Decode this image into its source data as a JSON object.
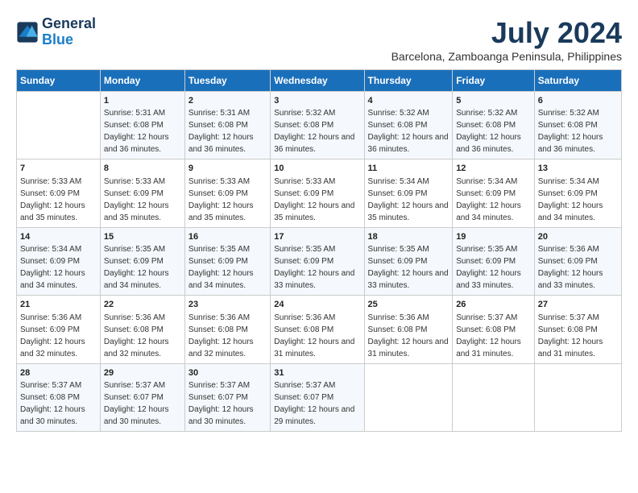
{
  "logo": {
    "line1": "General",
    "line2": "Blue"
  },
  "title": "July 2024",
  "subtitle": "Barcelona, Zamboanga Peninsula, Philippines",
  "weekdays": [
    "Sunday",
    "Monday",
    "Tuesday",
    "Wednesday",
    "Thursday",
    "Friday",
    "Saturday"
  ],
  "weeks": [
    [
      {
        "day": "",
        "sunrise": "",
        "sunset": "",
        "daylight": ""
      },
      {
        "day": "1",
        "sunrise": "Sunrise: 5:31 AM",
        "sunset": "Sunset: 6:08 PM",
        "daylight": "Daylight: 12 hours and 36 minutes."
      },
      {
        "day": "2",
        "sunrise": "Sunrise: 5:31 AM",
        "sunset": "Sunset: 6:08 PM",
        "daylight": "Daylight: 12 hours and 36 minutes."
      },
      {
        "day": "3",
        "sunrise": "Sunrise: 5:32 AM",
        "sunset": "Sunset: 6:08 PM",
        "daylight": "Daylight: 12 hours and 36 minutes."
      },
      {
        "day": "4",
        "sunrise": "Sunrise: 5:32 AM",
        "sunset": "Sunset: 6:08 PM",
        "daylight": "Daylight: 12 hours and 36 minutes."
      },
      {
        "day": "5",
        "sunrise": "Sunrise: 5:32 AM",
        "sunset": "Sunset: 6:08 PM",
        "daylight": "Daylight: 12 hours and 36 minutes."
      },
      {
        "day": "6",
        "sunrise": "Sunrise: 5:32 AM",
        "sunset": "Sunset: 6:08 PM",
        "daylight": "Daylight: 12 hours and 36 minutes."
      }
    ],
    [
      {
        "day": "7",
        "sunrise": "Sunrise: 5:33 AM",
        "sunset": "Sunset: 6:09 PM",
        "daylight": "Daylight: 12 hours and 35 minutes."
      },
      {
        "day": "8",
        "sunrise": "Sunrise: 5:33 AM",
        "sunset": "Sunset: 6:09 PM",
        "daylight": "Daylight: 12 hours and 35 minutes."
      },
      {
        "day": "9",
        "sunrise": "Sunrise: 5:33 AM",
        "sunset": "Sunset: 6:09 PM",
        "daylight": "Daylight: 12 hours and 35 minutes."
      },
      {
        "day": "10",
        "sunrise": "Sunrise: 5:33 AM",
        "sunset": "Sunset: 6:09 PM",
        "daylight": "Daylight: 12 hours and 35 minutes."
      },
      {
        "day": "11",
        "sunrise": "Sunrise: 5:34 AM",
        "sunset": "Sunset: 6:09 PM",
        "daylight": "Daylight: 12 hours and 35 minutes."
      },
      {
        "day": "12",
        "sunrise": "Sunrise: 5:34 AM",
        "sunset": "Sunset: 6:09 PM",
        "daylight": "Daylight: 12 hours and 34 minutes."
      },
      {
        "day": "13",
        "sunrise": "Sunrise: 5:34 AM",
        "sunset": "Sunset: 6:09 PM",
        "daylight": "Daylight: 12 hours and 34 minutes."
      }
    ],
    [
      {
        "day": "14",
        "sunrise": "Sunrise: 5:34 AM",
        "sunset": "Sunset: 6:09 PM",
        "daylight": "Daylight: 12 hours and 34 minutes."
      },
      {
        "day": "15",
        "sunrise": "Sunrise: 5:35 AM",
        "sunset": "Sunset: 6:09 PM",
        "daylight": "Daylight: 12 hours and 34 minutes."
      },
      {
        "day": "16",
        "sunrise": "Sunrise: 5:35 AM",
        "sunset": "Sunset: 6:09 PM",
        "daylight": "Daylight: 12 hours and 34 minutes."
      },
      {
        "day": "17",
        "sunrise": "Sunrise: 5:35 AM",
        "sunset": "Sunset: 6:09 PM",
        "daylight": "Daylight: 12 hours and 33 minutes."
      },
      {
        "day": "18",
        "sunrise": "Sunrise: 5:35 AM",
        "sunset": "Sunset: 6:09 PM",
        "daylight": "Daylight: 12 hours and 33 minutes."
      },
      {
        "day": "19",
        "sunrise": "Sunrise: 5:35 AM",
        "sunset": "Sunset: 6:09 PM",
        "daylight": "Daylight: 12 hours and 33 minutes."
      },
      {
        "day": "20",
        "sunrise": "Sunrise: 5:36 AM",
        "sunset": "Sunset: 6:09 PM",
        "daylight": "Daylight: 12 hours and 33 minutes."
      }
    ],
    [
      {
        "day": "21",
        "sunrise": "Sunrise: 5:36 AM",
        "sunset": "Sunset: 6:09 PM",
        "daylight": "Daylight: 12 hours and 32 minutes."
      },
      {
        "day": "22",
        "sunrise": "Sunrise: 5:36 AM",
        "sunset": "Sunset: 6:08 PM",
        "daylight": "Daylight: 12 hours and 32 minutes."
      },
      {
        "day": "23",
        "sunrise": "Sunrise: 5:36 AM",
        "sunset": "Sunset: 6:08 PM",
        "daylight": "Daylight: 12 hours and 32 minutes."
      },
      {
        "day": "24",
        "sunrise": "Sunrise: 5:36 AM",
        "sunset": "Sunset: 6:08 PM",
        "daylight": "Daylight: 12 hours and 31 minutes."
      },
      {
        "day": "25",
        "sunrise": "Sunrise: 5:36 AM",
        "sunset": "Sunset: 6:08 PM",
        "daylight": "Daylight: 12 hours and 31 minutes."
      },
      {
        "day": "26",
        "sunrise": "Sunrise: 5:37 AM",
        "sunset": "Sunset: 6:08 PM",
        "daylight": "Daylight: 12 hours and 31 minutes."
      },
      {
        "day": "27",
        "sunrise": "Sunrise: 5:37 AM",
        "sunset": "Sunset: 6:08 PM",
        "daylight": "Daylight: 12 hours and 31 minutes."
      }
    ],
    [
      {
        "day": "28",
        "sunrise": "Sunrise: 5:37 AM",
        "sunset": "Sunset: 6:08 PM",
        "daylight": "Daylight: 12 hours and 30 minutes."
      },
      {
        "day": "29",
        "sunrise": "Sunrise: 5:37 AM",
        "sunset": "Sunset: 6:07 PM",
        "daylight": "Daylight: 12 hours and 30 minutes."
      },
      {
        "day": "30",
        "sunrise": "Sunrise: 5:37 AM",
        "sunset": "Sunset: 6:07 PM",
        "daylight": "Daylight: 12 hours and 30 minutes."
      },
      {
        "day": "31",
        "sunrise": "Sunrise: 5:37 AM",
        "sunset": "Sunset: 6:07 PM",
        "daylight": "Daylight: 12 hours and 29 minutes."
      },
      {
        "day": "",
        "sunrise": "",
        "sunset": "",
        "daylight": ""
      },
      {
        "day": "",
        "sunrise": "",
        "sunset": "",
        "daylight": ""
      },
      {
        "day": "",
        "sunrise": "",
        "sunset": "",
        "daylight": ""
      }
    ]
  ]
}
